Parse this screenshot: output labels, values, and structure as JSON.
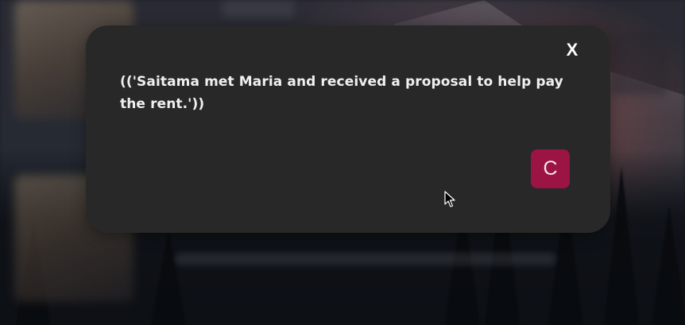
{
  "dialog": {
    "message": "(('Saitama met Maria and received a proposal to help pay the rent.'))",
    "close_label": "X",
    "continue_label": "C"
  },
  "colors": {
    "dialog_background": "#282828",
    "continue_button": "#9b1443",
    "text": "#f0f0f0"
  },
  "icons": {
    "cursor": "mouse-pointer-icon"
  }
}
